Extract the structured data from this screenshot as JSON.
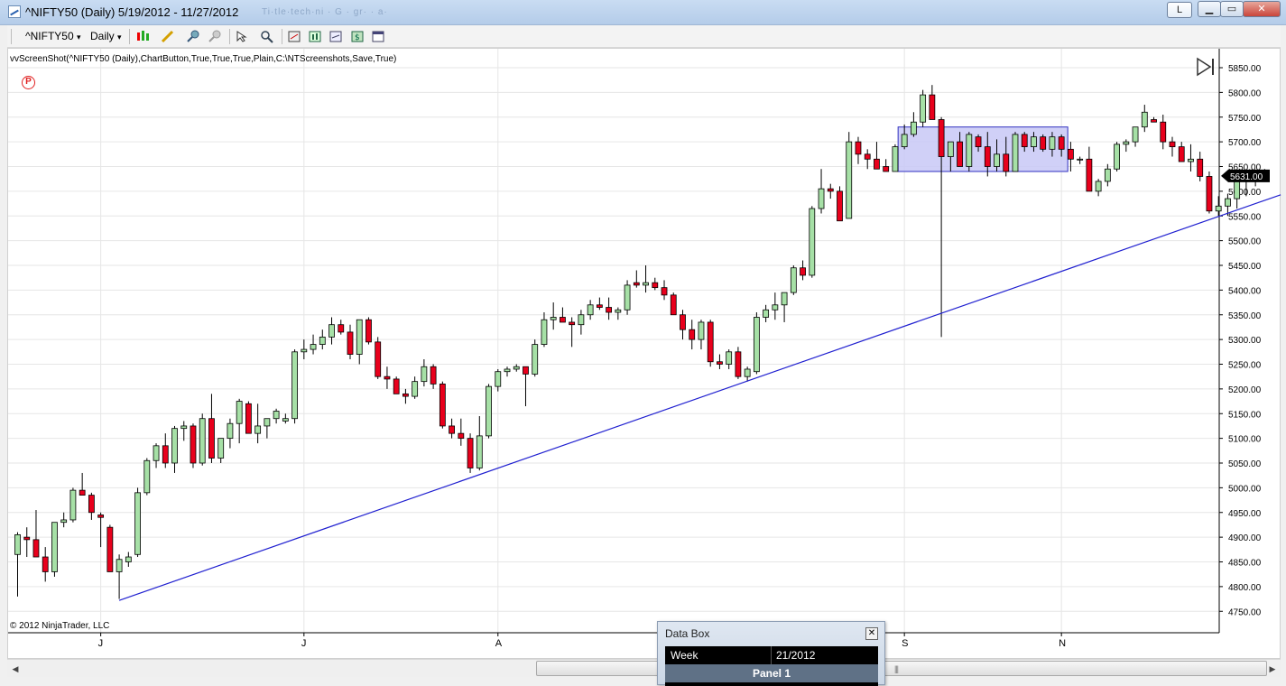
{
  "window": {
    "title": "^NIFTY50 (Daily)  5/19/2012 - 11/27/2012",
    "faint_tabs": "Ti·tle·tech·ni  ·  G  ·  gr·  ·  a·",
    "link_button": "L",
    "min_symbol": "▁",
    "max_symbol": "▭",
    "close_symbol": "✕"
  },
  "toolbar": {
    "instrument": "^NIFTY50",
    "interval": "Daily",
    "dropdown_symbol": "▾"
  },
  "chart": {
    "indicator_label": "vvScreenShot(^NIFTY50 (Daily),ChartButton,True,True,True,Plain,C:\\NTScreenshots,Save,True)",
    "copyright": "© 2012 NinjaTrader, LLC",
    "p_marker": "P",
    "last_price_label": "5631.00"
  },
  "colors": {
    "up_candle": "#a6e0a6",
    "down_candle": "#e8001c",
    "trendline": "#2020d0",
    "rectangle_fill": "#c8c8f6",
    "rectangle_stroke": "#3030c0",
    "grid": "#e6e6e6"
  },
  "chart_data": {
    "type": "candlestick",
    "title": "^NIFTY50 (Daily)",
    "ylim": [
      4725,
      5875
    ],
    "y_ticks": [
      4750,
      4800,
      4850,
      4900,
      4950,
      5000,
      5050,
      5100,
      5150,
      5200,
      5250,
      5300,
      5350,
      5400,
      5450,
      5500,
      5550,
      5600,
      5650,
      5700,
      5750,
      5800,
      5850
    ],
    "x_ticks": [
      {
        "label": "J",
        "bar": 9
      },
      {
        "label": "J",
        "bar": 31
      },
      {
        "label": "A",
        "bar": 52
      },
      {
        "label": "S",
        "bar": 96
      },
      {
        "label": "N",
        "bar": 113
      }
    ],
    "last_price": 5631.0,
    "grid": true,
    "candles": [
      [
        4865,
        4910,
        4780,
        4905
      ],
      [
        4900,
        4920,
        4860,
        4895
      ],
      [
        4895,
        4955,
        4880,
        4860
      ],
      [
        4860,
        4880,
        4810,
        4830
      ],
      [
        4830,
        4930,
        4820,
        4930
      ],
      [
        4930,
        4950,
        4920,
        4935
      ],
      [
        4935,
        5000,
        4930,
        4995
      ],
      [
        4995,
        5030,
        4985,
        4985
      ],
      [
        4985,
        4990,
        4935,
        4950
      ],
      [
        4945,
        4950,
        4880,
        4940
      ],
      [
        4920,
        4925,
        4830,
        4830
      ],
      [
        4830,
        4865,
        4775,
        4855
      ],
      [
        4850,
        4870,
        4840,
        4860
      ],
      [
        4865,
        5000,
        4860,
        4990
      ],
      [
        4990,
        5060,
        4985,
        5055
      ],
      [
        5055,
        5090,
        5040,
        5085
      ],
      [
        5085,
        5110,
        5040,
        5050
      ],
      [
        5050,
        5125,
        5030,
        5120
      ],
      [
        5120,
        5135,
        5095,
        5125
      ],
      [
        5125,
        5130,
        5040,
        5050
      ],
      [
        5050,
        5150,
        5045,
        5140
      ],
      [
        5140,
        5190,
        5050,
        5060
      ],
      [
        5060,
        5100,
        5050,
        5100
      ],
      [
        5100,
        5140,
        5080,
        5130
      ],
      [
        5130,
        5180,
        5090,
        5175
      ],
      [
        5170,
        5175,
        5120,
        5110
      ],
      [
        5110,
        5170,
        5090,
        5125
      ],
      [
        5125,
        5140,
        5100,
        5140
      ],
      [
        5140,
        5160,
        5130,
        5155
      ],
      [
        5135,
        5150,
        5130,
        5140
      ],
      [
        5140,
        5280,
        5130,
        5275
      ],
      [
        5275,
        5300,
        5260,
        5280
      ],
      [
        5280,
        5310,
        5270,
        5290
      ],
      [
        5290,
        5320,
        5280,
        5305
      ],
      [
        5305,
        5345,
        5290,
        5330
      ],
      [
        5330,
        5340,
        5310,
        5315
      ],
      [
        5315,
        5330,
        5260,
        5270
      ],
      [
        5270,
        5340,
        5250,
        5340
      ],
      [
        5340,
        5345,
        5290,
        5295
      ],
      [
        5295,
        5305,
        5220,
        5225
      ],
      [
        5225,
        5245,
        5200,
        5220
      ],
      [
        5220,
        5225,
        5190,
        5190
      ],
      [
        5190,
        5200,
        5170,
        5185
      ],
      [
        5185,
        5225,
        5180,
        5215
      ],
      [
        5215,
        5260,
        5205,
        5245
      ],
      [
        5245,
        5250,
        5200,
        5210
      ],
      [
        5210,
        5215,
        5120,
        5125
      ],
      [
        5125,
        5140,
        5100,
        5110
      ],
      [
        5110,
        5140,
        5085,
        5100
      ],
      [
        5100,
        5110,
        5030,
        5040
      ],
      [
        5040,
        5145,
        5035,
        5105
      ],
      [
        5105,
        5210,
        5100,
        5205
      ],
      [
        5205,
        5240,
        5195,
        5235
      ],
      [
        5235,
        5245,
        5225,
        5240
      ],
      [
        5240,
        5250,
        5235,
        5245
      ],
      [
        5245,
        5245,
        5165,
        5230
      ],
      [
        5230,
        5300,
        5225,
        5290
      ],
      [
        5290,
        5355,
        5285,
        5340
      ],
      [
        5340,
        5375,
        5320,
        5345
      ],
      [
        5345,
        5365,
        5335,
        5335
      ],
      [
        5335,
        5345,
        5285,
        5330
      ],
      [
        5330,
        5360,
        5310,
        5350
      ],
      [
        5350,
        5380,
        5340,
        5370
      ],
      [
        5370,
        5385,
        5360,
        5365
      ],
      [
        5365,
        5385,
        5340,
        5355
      ],
      [
        5355,
        5365,
        5340,
        5360
      ],
      [
        5360,
        5420,
        5350,
        5410
      ],
      [
        5415,
        5440,
        5405,
        5410
      ],
      [
        5410,
        5450,
        5395,
        5415
      ],
      [
        5415,
        5425,
        5400,
        5405
      ],
      [
        5405,
        5420,
        5380,
        5390
      ],
      [
        5390,
        5395,
        5350,
        5350
      ],
      [
        5350,
        5360,
        5300,
        5320
      ],
      [
        5320,
        5340,
        5280,
        5300
      ],
      [
        5300,
        5340,
        5280,
        5335
      ],
      [
        5335,
        5340,
        5245,
        5255
      ],
      [
        5255,
        5270,
        5240,
        5250
      ],
      [
        5250,
        5280,
        5240,
        5275
      ],
      [
        5275,
        5285,
        5220,
        5225
      ],
      [
        5225,
        5245,
        5215,
        5240
      ],
      [
        5235,
        5355,
        5230,
        5345
      ],
      [
        5345,
        5370,
        5335,
        5360
      ],
      [
        5360,
        5395,
        5340,
        5370
      ],
      [
        5370,
        5395,
        5335,
        5395
      ],
      [
        5395,
        5450,
        5390,
        5445
      ],
      [
        5445,
        5460,
        5420,
        5430
      ],
      [
        5430,
        5570,
        5425,
        5565
      ],
      [
        5565,
        5645,
        5555,
        5605
      ],
      [
        5605,
        5615,
        5585,
        5600
      ],
      [
        5600,
        5610,
        5540,
        5540
      ],
      [
        5545,
        5720,
        5545,
        5700
      ],
      [
        5700,
        5710,
        5655,
        5675
      ],
      [
        5675,
        5685,
        5645,
        5665
      ],
      [
        5665,
        5700,
        5650,
        5645
      ],
      [
        5650,
        5665,
        5640,
        5640
      ],
      [
        5640,
        5695,
        5640,
        5690
      ],
      [
        5690,
        5735,
        5685,
        5715
      ],
      [
        5715,
        5760,
        5710,
        5740
      ],
      [
        5740,
        5805,
        5730,
        5795
      ],
      [
        5795,
        5815,
        5750,
        5745
      ],
      [
        5745,
        5750,
        5305,
        5670
      ],
      [
        5670,
        5700,
        5640,
        5700
      ],
      [
        5700,
        5720,
        5650,
        5650
      ],
      [
        5650,
        5720,
        5640,
        5715
      ],
      [
        5710,
        5715,
        5680,
        5690
      ],
      [
        5690,
        5720,
        5630,
        5650
      ],
      [
        5650,
        5705,
        5640,
        5675
      ],
      [
        5675,
        5710,
        5630,
        5640
      ],
      [
        5640,
        5720,
        5640,
        5715
      ],
      [
        5715,
        5720,
        5680,
        5690
      ],
      [
        5690,
        5720,
        5680,
        5710
      ],
      [
        5710,
        5715,
        5680,
        5685
      ],
      [
        5685,
        5720,
        5670,
        5710
      ],
      [
        5710,
        5715,
        5670,
        5685
      ],
      [
        5685,
        5700,
        5640,
        5665
      ],
      [
        5665,
        5670,
        5655,
        5665
      ],
      [
        5665,
        5690,
        5600,
        5600
      ],
      [
        5600,
        5625,
        5590,
        5620
      ],
      [
        5620,
        5655,
        5610,
        5645
      ],
      [
        5645,
        5700,
        5640,
        5695
      ],
      [
        5695,
        5705,
        5680,
        5700
      ],
      [
        5700,
        5730,
        5690,
        5730
      ],
      [
        5730,
        5775,
        5720,
        5760
      ],
      [
        5745,
        5750,
        5740,
        5740
      ],
      [
        5740,
        5755,
        5685,
        5700
      ],
      [
        5700,
        5710,
        5670,
        5690
      ],
      [
        5690,
        5700,
        5660,
        5660
      ],
      [
        5660,
        5695,
        5640,
        5665
      ],
      [
        5665,
        5680,
        5620,
        5630
      ],
      [
        5630,
        5640,
        5555,
        5560
      ],
      [
        5560,
        5590,
        5550,
        5570
      ],
      [
        5570,
        5595,
        5550,
        5585
      ],
      [
        5585,
        5620,
        5565,
        5620
      ],
      [
        5620,
        5640,
        5590,
        5625
      ],
      [
        5630,
        5635,
        5610,
        5625
      ],
      [
        5625,
        5645,
        5620,
        5630
      ]
    ],
    "trendline": {
      "from": {
        "bar": 11,
        "price": 4772
      },
      "to": {
        "bar": 134,
        "price": 5592
      }
    },
    "rectangle": {
      "from_bar": 96,
      "to_bar": 113,
      "top": 5730,
      "bottom": 5640
    }
  },
  "databox": {
    "title": "Data Box",
    "close_symbol": "✕",
    "row_label": "Week",
    "row_value": "21/2012",
    "panel_label": "Panel 1"
  },
  "scrollbar": {
    "left_arrow": "◀",
    "right_arrow": "▶",
    "grip": "|||"
  }
}
